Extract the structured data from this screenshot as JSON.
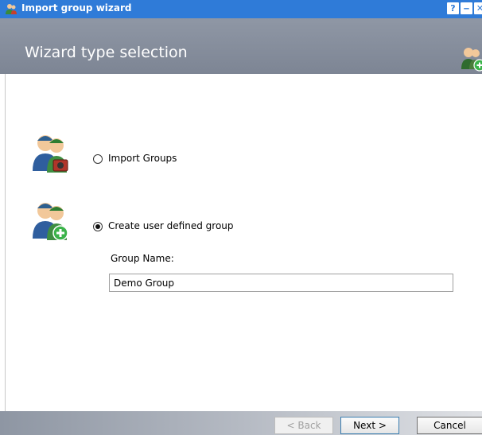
{
  "window": {
    "title": "Import group wizard"
  },
  "titlebar_buttons": {
    "help": "?",
    "minimize": "‒",
    "close": "✕"
  },
  "header": {
    "title": "Wizard type selection"
  },
  "options": [
    {
      "label": "Import Groups",
      "selected": false
    },
    {
      "label": "Create user defined group",
      "selected": true
    }
  ],
  "group_name": {
    "label": "Group Name:",
    "value": "Demo Group"
  },
  "buttons": {
    "back": "< Back",
    "next": "Next >",
    "cancel": "Cancel"
  },
  "colors": {
    "titlebar": "#2f7bd8",
    "header": "#8f97a5",
    "accent_green": "#3bb34a"
  }
}
